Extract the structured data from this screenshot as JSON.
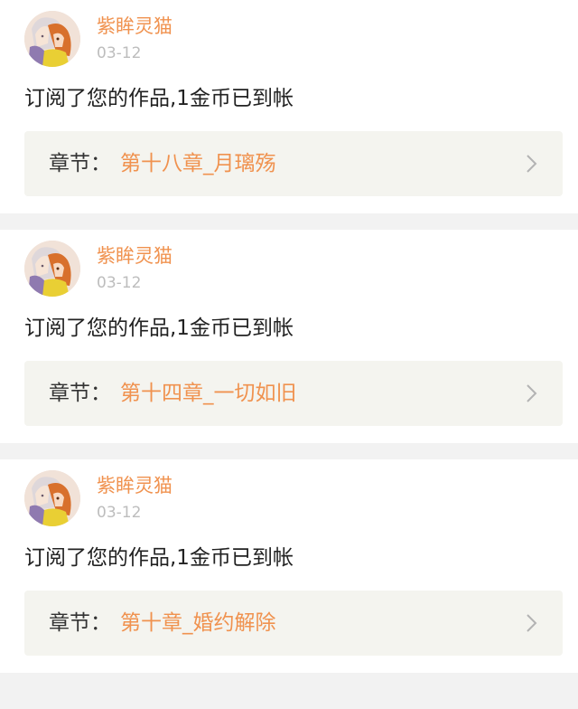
{
  "notifications": [
    {
      "username": "紫眸灵猫",
      "date": "03-12",
      "message": "订阅了您的作品,1金币已到帐",
      "chapter_label": "章节：",
      "chapter_title": "第十八章_月璃殇"
    },
    {
      "username": "紫眸灵猫",
      "date": "03-12",
      "message": "订阅了您的作品,1金币已到帐",
      "chapter_label": "章节：",
      "chapter_title": "第十四章_一切如旧"
    },
    {
      "username": "紫眸灵猫",
      "date": "03-12",
      "message": "订阅了您的作品,1金币已到帐",
      "chapter_label": "章节：",
      "chapter_title": "第十章_婚约解除"
    }
  ],
  "colors": {
    "accent": "#f0924f",
    "date": "#bdbdbd",
    "text": "#222222",
    "chapter_bg": "#f4f4ef",
    "page_bg": "#f2f2f2"
  },
  "icons": {
    "avatar": "anime-avatar-image",
    "chevron": "chevron-right-icon"
  }
}
